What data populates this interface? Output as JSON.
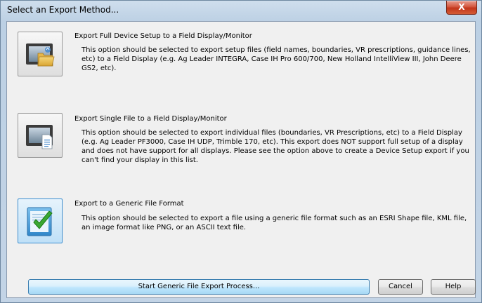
{
  "window": {
    "title": "Select an Export Method...",
    "close_glyph": "X"
  },
  "options": [
    {
      "title": "Export Full Device Setup to a Field Display/Monitor",
      "description": "This option should be selected to export setup files (field names, boundaries, VR prescriptions, guidance lines, etc) to a Field Display (e.g. Ag Leader INTEGRA, Case IH Pro 600/700, New Holland IntelliView III, John Deere GS2, etc).",
      "icon": "monitor-folder-icon"
    },
    {
      "title": "Export Single File to a Field Display/Monitor",
      "description": "This option should be selected to export individual files (boundaries, VR Prescriptions, etc) to a Field Display (e.g. Ag Leader PF3000, Case IH UDP, Trimble 170, etc).  This export does NOT support full setup of a display and does not have support for all displays.  Please see the option above to create a Device Setup export if you can't find your display in this list.",
      "icon": "monitor-document-icon"
    },
    {
      "title": "Export to a Generic File Format",
      "description": "This option should be selected to export a file using a generic file format such as an ESRI Shape file, KML file, an image format like PNG, or an ASCII text file.",
      "icon": "document-checkmark-icon",
      "selected": true
    }
  ],
  "buttons": {
    "start": "Start Generic File Export Process...",
    "cancel": "Cancel",
    "help": "Help"
  },
  "colors": {
    "selection_accent": "#3c8ed0",
    "checkmark": "#3aa832",
    "close_red": "#c2361b"
  }
}
